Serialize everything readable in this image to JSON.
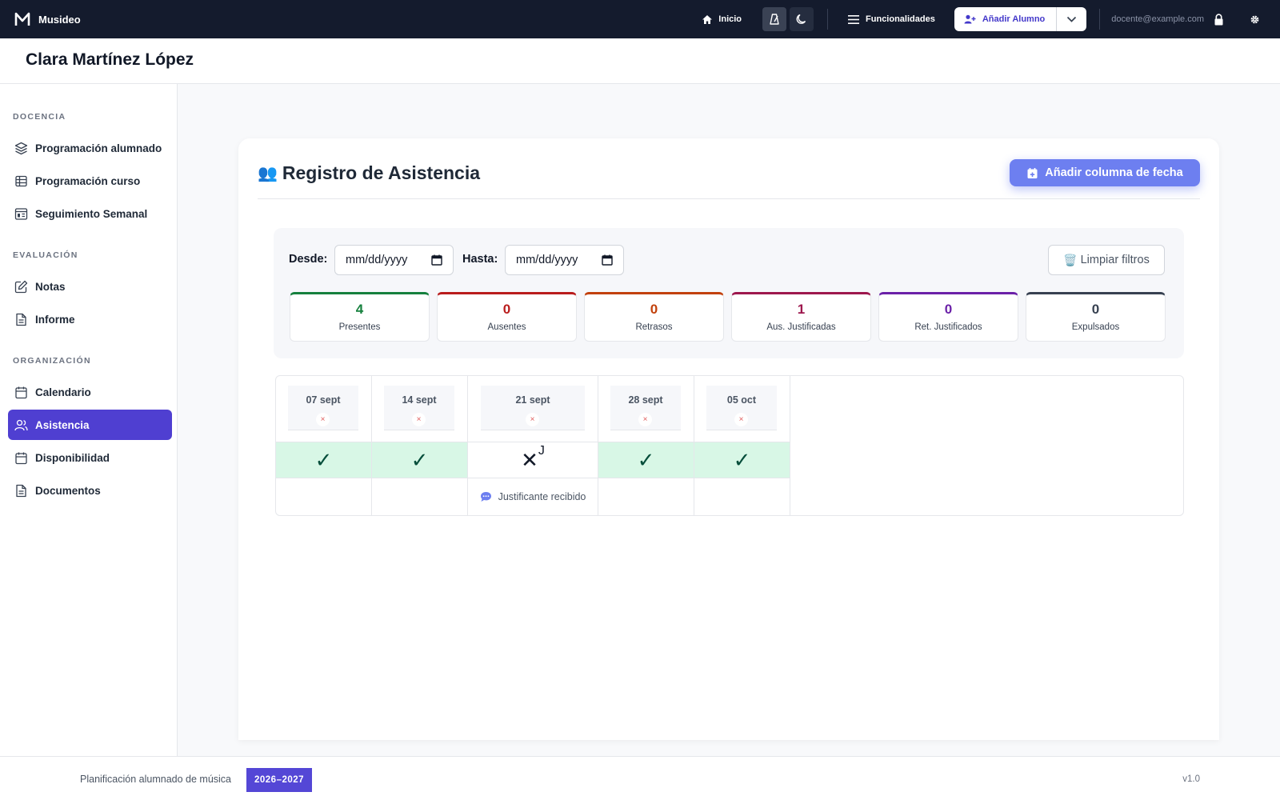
{
  "brand": {
    "name": "Musideo"
  },
  "nav": {
    "home_label": "Inicio",
    "features_label": "Funcionalidades",
    "add_student_label": "Añadir Alumno",
    "user_email": "docente@example.com"
  },
  "student": {
    "name": "Clara Martínez López"
  },
  "sidebar": {
    "sections": [
      {
        "title": "DOCENCIA"
      },
      {
        "title": "EVALUACIÓN"
      },
      {
        "title": "ORGANIZACIÓN"
      }
    ],
    "items": [
      {
        "label": "Programación alumnado",
        "icon": "layers-icon"
      },
      {
        "label": "Programación curso",
        "icon": "table-icon"
      },
      {
        "label": "Seguimiento Semanal",
        "icon": "dashboard-icon"
      },
      {
        "label": "Notas",
        "icon": "edit-icon"
      },
      {
        "label": "Informe",
        "icon": "document-icon"
      },
      {
        "label": "Calendario",
        "icon": "calendar-icon"
      },
      {
        "label": "Asistencia",
        "icon": "users-icon",
        "active": true
      },
      {
        "label": "Disponibilidad",
        "icon": "calendar-icon"
      },
      {
        "label": "Documentos",
        "icon": "document-icon"
      }
    ]
  },
  "attendance": {
    "title": "Registro de Asistencia",
    "add_column_label": "Añadir columna de fecha",
    "filters": {
      "from_label": "Desde:",
      "to_label": "Hasta:",
      "from_value": "mm/dd/yyyy",
      "to_value": "mm/dd/yyyy",
      "clear_label": "Limpiar filtros"
    },
    "stats": [
      {
        "value": "4",
        "label": "Presentes",
        "color": "#15803d"
      },
      {
        "value": "0",
        "label": "Ausentes",
        "color": "#b91c1c"
      },
      {
        "value": "0",
        "label": "Retrasos",
        "color": "#c2410c"
      },
      {
        "value": "1",
        "label": "Aus. Justificadas",
        "color": "#9d174d"
      },
      {
        "value": "0",
        "label": "Ret. Justificados",
        "color": "#6b21a8"
      },
      {
        "value": "0",
        "label": "Expulsados",
        "color": "#374151"
      }
    ],
    "columns": [
      {
        "date": "07 sept",
        "status": "present",
        "mark": "✓"
      },
      {
        "date": "14 sept",
        "status": "present",
        "mark": "✓"
      },
      {
        "date": "21 sept",
        "status": "justified",
        "mark": "✕",
        "mark_sup": "J",
        "note": "Justificante recibido"
      },
      {
        "date": "28 sept",
        "status": "present",
        "mark": "✓"
      },
      {
        "date": "05 oct",
        "status": "present",
        "mark": "✓"
      }
    ],
    "delete_glyph": "×"
  },
  "footer": {
    "text": "Planificación alumnado de música",
    "year": "2026–2027",
    "version": "v1.0"
  }
}
